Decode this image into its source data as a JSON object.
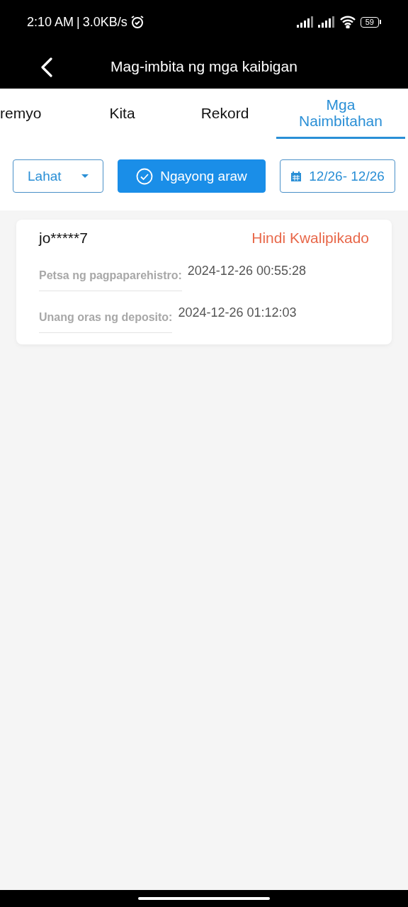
{
  "status_bar": {
    "time": "2:10 AM",
    "separator": "|",
    "speed": "3.0KB/s",
    "battery": "59"
  },
  "header": {
    "title": "Mag-imbita ng mga kaibigan"
  },
  "tabs": [
    {
      "label": "remyo",
      "selected": false
    },
    {
      "label": "Kita",
      "selected": false
    },
    {
      "label": "Rekord",
      "selected": false
    },
    {
      "label": "Mga Naimbitahan",
      "selected": true
    }
  ],
  "filters": [
    {
      "kind": "dropdown",
      "label": "Lahat",
      "selected": false
    },
    {
      "kind": "toggle",
      "label": "Ngayong araw",
      "selected": true
    },
    {
      "kind": "date",
      "label": "12/26- 12/26",
      "selected": false
    }
  ],
  "records": [
    {
      "user": "jo*****7",
      "status": "Hindi Kwalipikado",
      "color": "#e8684a",
      "fields": [
        {
          "label": "Petsa ng pagpaparehistro:",
          "value": "2024-12-26 00:55:28"
        },
        {
          "label": "Unang oras ng deposito:",
          "value": "2024-12-26 01:12:03"
        }
      ]
    }
  ]
}
